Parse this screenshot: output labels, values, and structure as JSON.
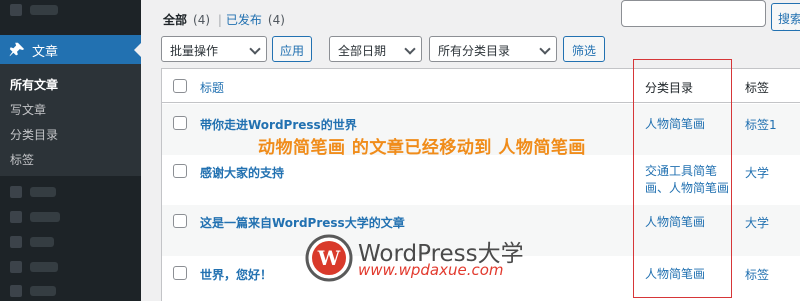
{
  "sidebar": {
    "menu_label": "文章",
    "submenu": [
      "所有文章",
      "写文章",
      "分类目录",
      "标签"
    ]
  },
  "views": {
    "all_label": "全部",
    "all_count": "(4)",
    "separator": "|",
    "published_label": "已发布",
    "published_count": "(4)"
  },
  "search": {
    "button_label": "搜索文章",
    "input_value": ""
  },
  "filters": {
    "bulk_action": "批量操作",
    "apply_label": "应用",
    "date_filter": "全部日期",
    "category_filter": "所有分类目录",
    "filter_label": "筛选"
  },
  "table": {
    "columns": {
      "title": "标题",
      "categories": "分类目录",
      "tags": "标签"
    },
    "rows": [
      {
        "title": "带你走进WordPress的世界",
        "categories": "人物简笔画",
        "tags": "标签1"
      },
      {
        "title": "感谢大家的支持",
        "categories": "交通工具简笔画、人物简笔画",
        "tags": "大学"
      },
      {
        "title": "这是一篇来自WordPress大学的文章",
        "categories": "人物简笔画",
        "tags": "大学"
      },
      {
        "title": "世界，您好！",
        "categories": "人物简笔画",
        "tags": "标签"
      }
    ]
  },
  "notice": "动物简笔画 的文章已经移动到 人物简笔画",
  "watermark": {
    "name": "WordPress大学",
    "url": "www.wpdaxue.com"
  },
  "colors": {
    "accent": "#2271b1",
    "sidebar_bg": "#1d2327",
    "notice": "#f08c1a",
    "highlight": "#d63638"
  }
}
